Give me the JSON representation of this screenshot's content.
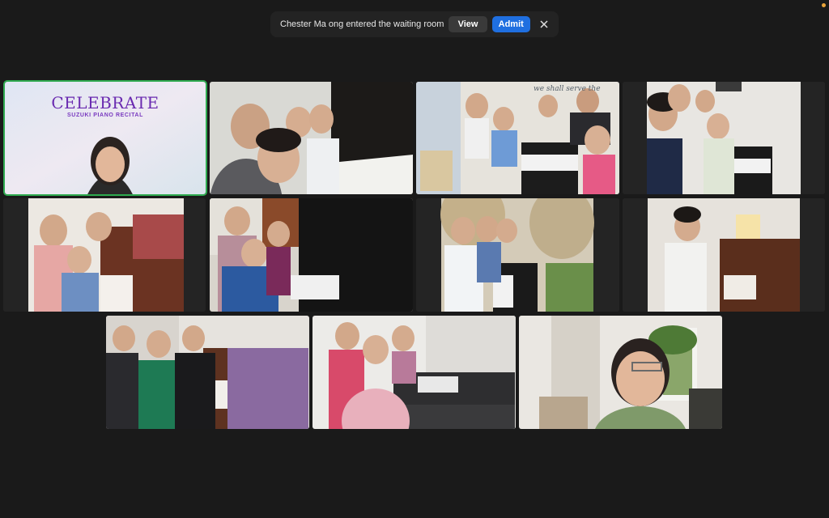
{
  "notification": {
    "message": "Chester Ma ong entered the waiting room",
    "view_label": "View",
    "admit_label": "Admit",
    "close_icon": "close-icon"
  },
  "tiles": [
    {
      "id": "tile-1",
      "title": "CELEBRATE",
      "subtitle": "SUZUKI PIANO RECITAL"
    },
    {
      "id": "tile-2"
    },
    {
      "id": "tile-3",
      "wall_text": "we shall serve the"
    },
    {
      "id": "tile-4"
    },
    {
      "id": "tile-5"
    },
    {
      "id": "tile-6"
    },
    {
      "id": "tile-7"
    },
    {
      "id": "tile-8"
    },
    {
      "id": "tile-9"
    },
    {
      "id": "tile-10"
    },
    {
      "id": "tile-11"
    }
  ],
  "colors": {
    "background": "#1a1a1a",
    "admit": "#1f6fe0",
    "active_speaker": "#2eaa4f",
    "celebrate_text": "#6a2bb0"
  }
}
